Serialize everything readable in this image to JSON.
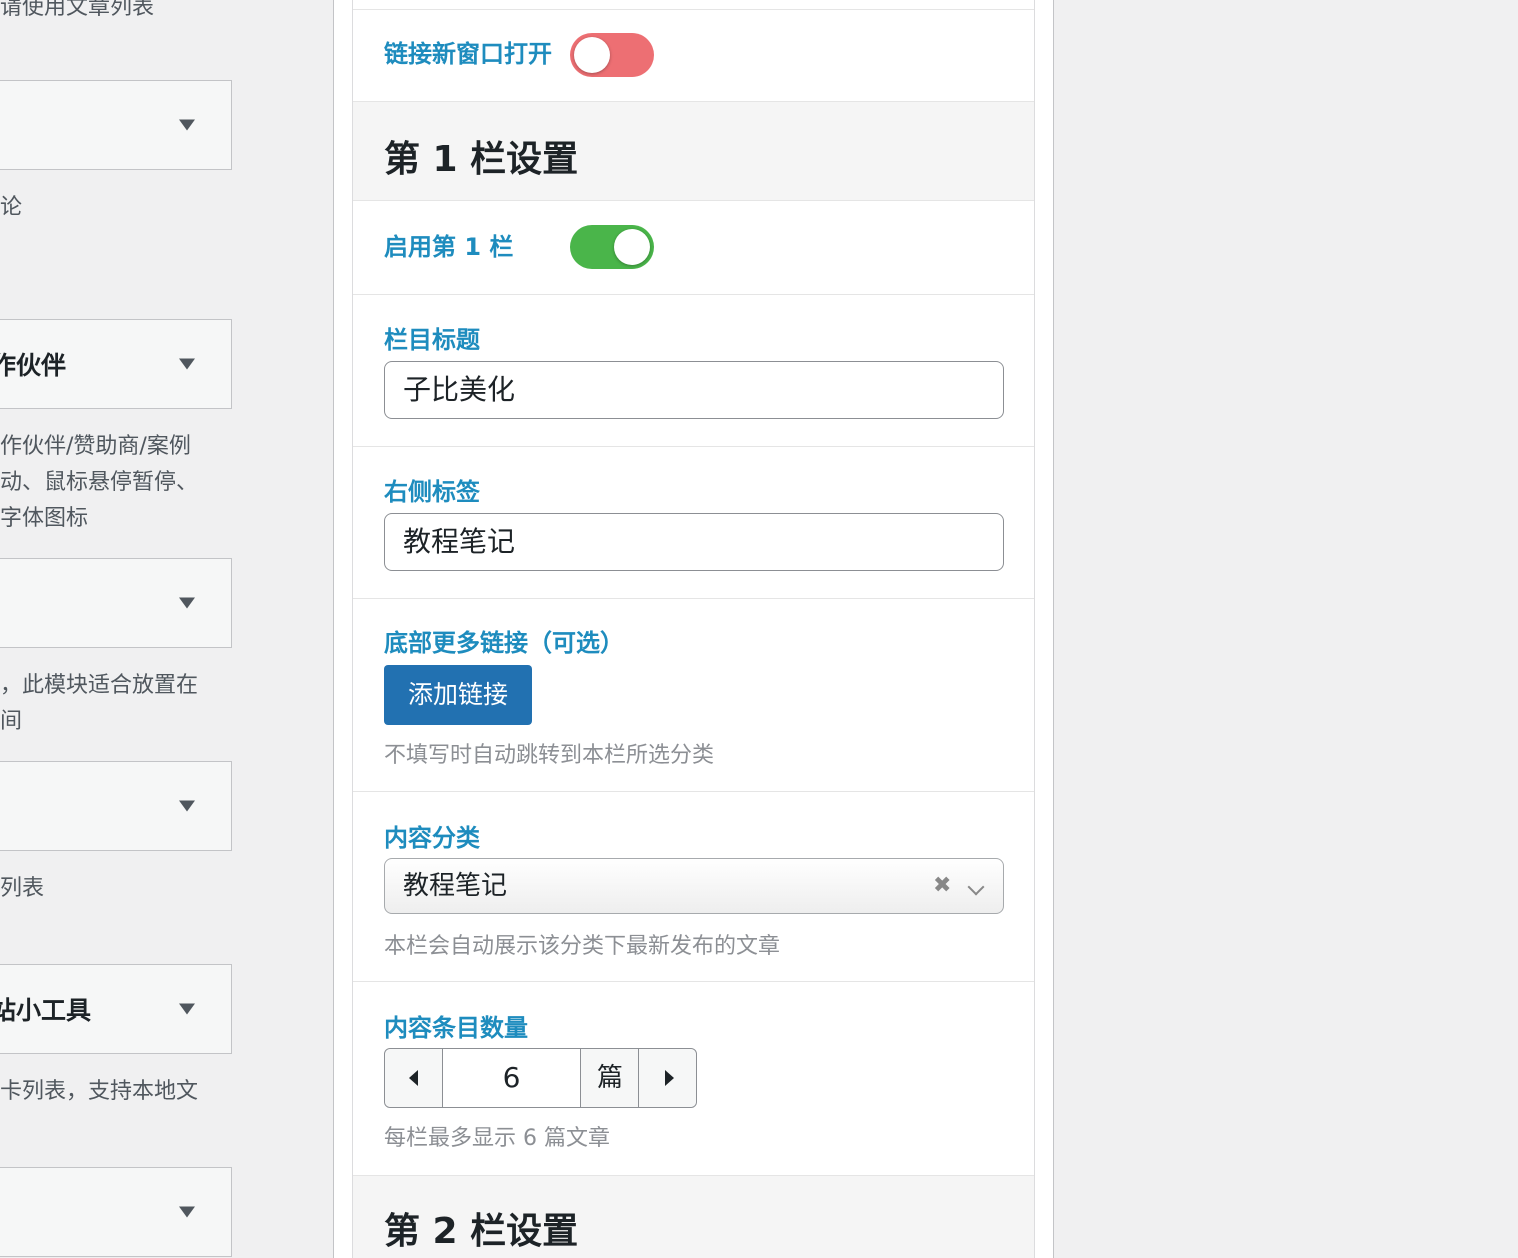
{
  "left_list": {
    "top_desc": "请使用文章列表",
    "widgets": [
      {
        "title": "",
        "desc": [
          "论"
        ]
      },
      {
        "title": "作伙伴",
        "desc": [
          "作伙伴/赞助商/案例",
          "动、鼠标悬停暂停、",
          "字体图标"
        ]
      },
      {
        "title": "",
        "desc": [
          "，此模块适合放置在",
          "间"
        ]
      },
      {
        "title": "",
        "desc": [
          "列表"
        ]
      },
      {
        "title": "站小工具",
        "desc": [
          "卡列表，支持本地文"
        ]
      },
      {
        "title": "",
        "desc": []
      }
    ]
  },
  "settings": {
    "new_window_label": "链接新窗口打开",
    "new_window_enabled": false,
    "section1_title": "第 1 栏设置",
    "enable_col1_label": "启用第 1 栏",
    "enable_col1_enabled": true,
    "col_title_label": "栏目标题",
    "col_title_value": "子比美化",
    "right_tag_label": "右侧标签",
    "right_tag_value": "教程笔记",
    "more_link_label": "底部更多链接（可选）",
    "add_link_button": "添加链接",
    "more_link_hint": "不填写时自动跳转到本栏所选分类",
    "category_label": "内容分类",
    "category_value": "教程笔记",
    "category_clear_icon": "✖",
    "category_hint": "本栏会自动展示该分类下最新发布的文章",
    "count_label": "内容条目数量",
    "count_value": "6",
    "count_unit": "篇",
    "count_hint": "每栏最多显示 6 篇文章",
    "section2_title": "第 2 栏设置"
  },
  "colors": {
    "label_blue": "#1e8cbe",
    "toggle_off": "#ed6f73",
    "toggle_on": "#4ab54a",
    "button_primary": "#2271b1"
  }
}
